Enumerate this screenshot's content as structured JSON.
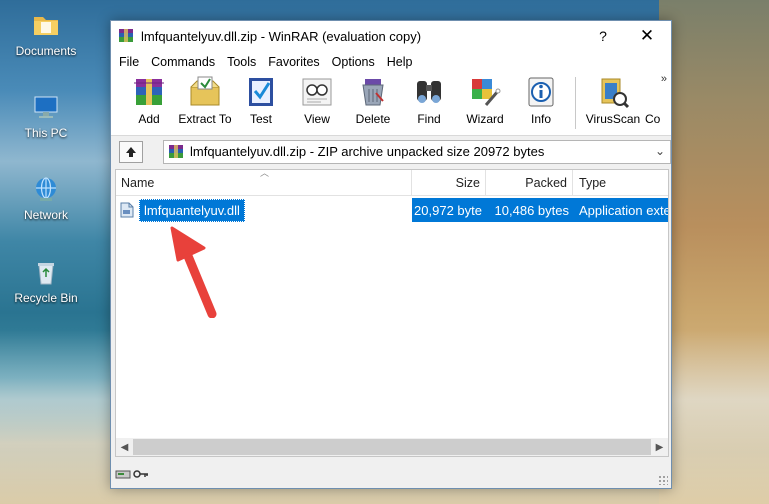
{
  "desktop": {
    "icons": [
      {
        "label": "Documents",
        "icon": "folder-icon"
      },
      {
        "label": "This PC",
        "icon": "computer-icon"
      },
      {
        "label": "Network",
        "icon": "network-icon"
      },
      {
        "label": "Recycle Bin",
        "icon": "recycle-bin-icon"
      }
    ]
  },
  "window": {
    "title": "lmfquantelyuv.dll.zip - WinRAR (evaluation copy)",
    "help_label": "?",
    "close_label": "✕"
  },
  "menu": [
    "File",
    "Commands",
    "Tools",
    "Favorites",
    "Options",
    "Help"
  ],
  "toolbar": {
    "buttons": [
      {
        "label": "Add",
        "icon": "add-archive-icon"
      },
      {
        "label": "Extract To",
        "icon": "extract-to-icon"
      },
      {
        "label": "Test",
        "icon": "test-icon"
      },
      {
        "label": "View",
        "icon": "view-icon"
      },
      {
        "label": "Delete",
        "icon": "delete-icon"
      },
      {
        "label": "Find",
        "icon": "find-icon"
      },
      {
        "label": "Wizard",
        "icon": "wizard-icon"
      },
      {
        "label": "Info",
        "icon": "info-icon"
      },
      {
        "label": "VirusScan",
        "icon": "virusscan-icon"
      },
      {
        "label": "Co",
        "icon": "comment-icon"
      }
    ],
    "overflow": "»"
  },
  "address": {
    "path": "lmfquantelyuv.dll.zip - ZIP archive unpacked size 20972 bytes"
  },
  "columns": {
    "name": "Name",
    "size": "Size",
    "packed": "Packed",
    "type": "Type"
  },
  "files": [
    {
      "name": "lmfquantelyuv.dll",
      "size": "20,972 byte",
      "packed": "10,486 bytes",
      "type": "Application exte"
    }
  ],
  "colors": {
    "selection": "#0078d7",
    "annotation_arrow": "#e8413b"
  }
}
